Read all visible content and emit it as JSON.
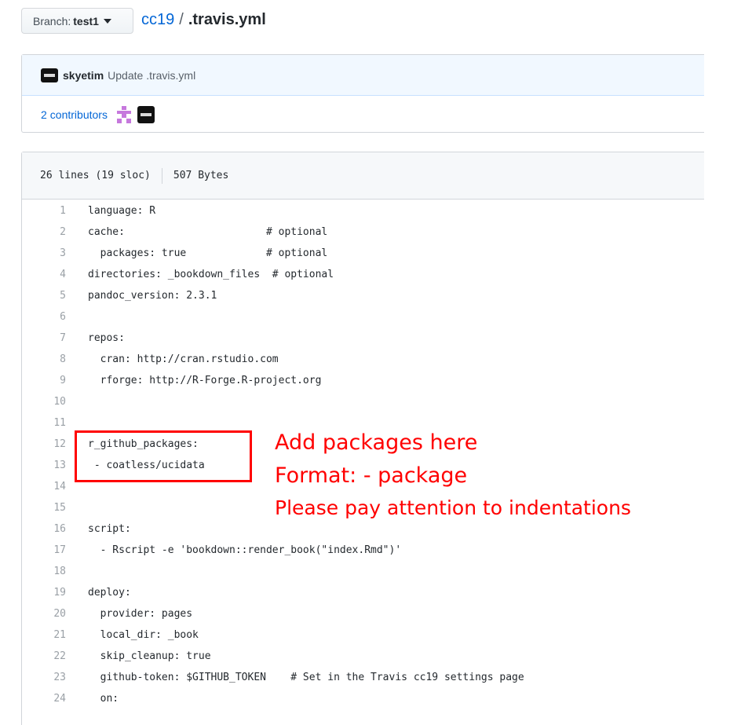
{
  "branch": {
    "prefix": "Branch:",
    "name": "test1"
  },
  "breadcrumb": {
    "repo": "cc19",
    "separator": "/",
    "file": ".travis.yml"
  },
  "commit": {
    "author": "skyetim",
    "message": "Update .travis.yml"
  },
  "contributors": {
    "count": "2",
    "label": "contributors"
  },
  "file_info": {
    "lines": "26 lines (19 sloc)",
    "size": "507 Bytes"
  },
  "code_lines": [
    {
      "n": "1",
      "text": "language: R"
    },
    {
      "n": "2",
      "text": "cache:                       # optional"
    },
    {
      "n": "3",
      "text": "  packages: true             # optional"
    },
    {
      "n": "4",
      "text": "directories: _bookdown_files  # optional"
    },
    {
      "n": "5",
      "text": "pandoc_version: 2.3.1"
    },
    {
      "n": "6",
      "text": ""
    },
    {
      "n": "7",
      "text": "repos:"
    },
    {
      "n": "8",
      "text": "  cran: http://cran.rstudio.com"
    },
    {
      "n": "9",
      "text": "  rforge: http://R-Forge.R-project.org"
    },
    {
      "n": "10",
      "text": ""
    },
    {
      "n": "11",
      "text": ""
    },
    {
      "n": "12",
      "text": "r_github_packages:"
    },
    {
      "n": "13",
      "text": " - coatless/ucidata"
    },
    {
      "n": "14",
      "text": ""
    },
    {
      "n": "15",
      "text": ""
    },
    {
      "n": "16",
      "text": "script:"
    },
    {
      "n": "17",
      "text": "  - Rscript -e 'bookdown::render_book(\"index.Rmd\")'"
    },
    {
      "n": "18",
      "text": ""
    },
    {
      "n": "19",
      "text": "deploy:"
    },
    {
      "n": "20",
      "text": "  provider: pages"
    },
    {
      "n": "21",
      "text": "  local_dir: _book"
    },
    {
      "n": "22",
      "text": "  skip_cleanup: true"
    },
    {
      "n": "23",
      "text": "  github-token: $GITHUB_TOKEN    # Set in the Travis cc19 settings page"
    },
    {
      "n": "24",
      "text": "  on:"
    }
  ],
  "annotations": {
    "line1": "Add packages here",
    "line2": "Format: - package",
    "line3": "Please pay attention to indentations"
  },
  "colors": {
    "link": "#0366d6",
    "annotation": "#ff0000"
  }
}
